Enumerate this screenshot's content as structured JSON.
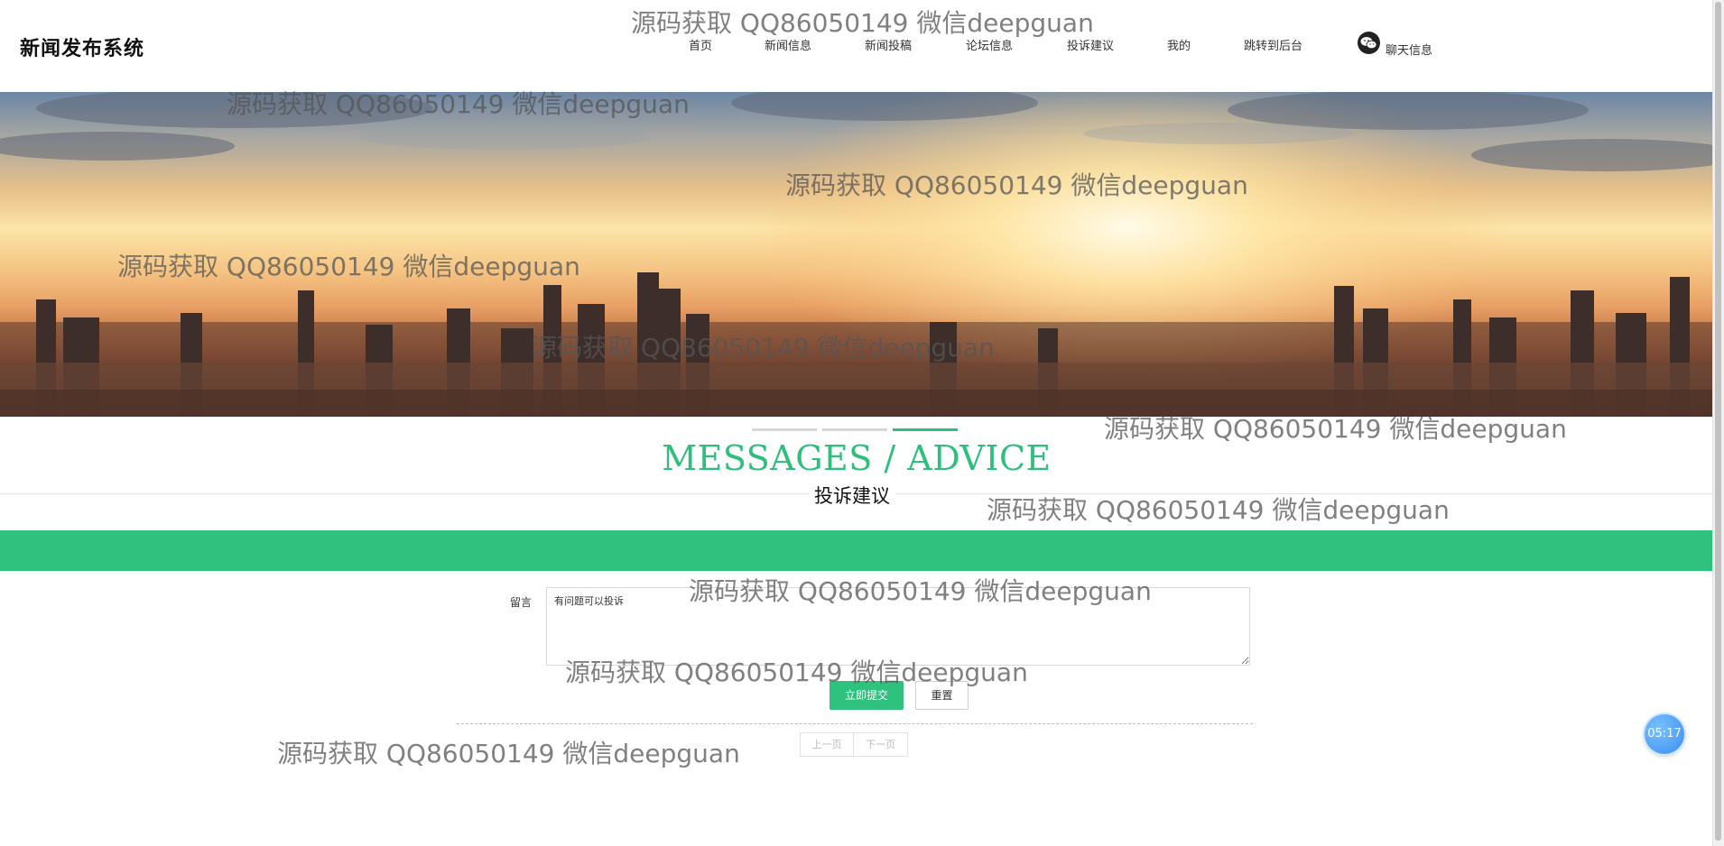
{
  "header": {
    "logo": "新闻发布系统",
    "nav": [
      {
        "label": "首页"
      },
      {
        "label": "新闻信息"
      },
      {
        "label": "新闻投稿"
      },
      {
        "label": "论坛信息"
      },
      {
        "label": "投诉建议"
      },
      {
        "label": "我的"
      },
      {
        "label": "跳转到后台"
      }
    ],
    "chat_label": "聊天信息",
    "chat_icon": "wechat-icon"
  },
  "banner": {
    "carousel_active_index": 2,
    "carousel_count": 3
  },
  "section": {
    "title_en": "MESSAGES / ADVICE",
    "title_cn": "投诉建议"
  },
  "form": {
    "message_label": "留言",
    "message_value": "有问题可以投诉",
    "submit_label": "立即提交",
    "reset_label": "重置"
  },
  "pagination": {
    "prev_label": "上一页",
    "next_label": "下一页"
  },
  "timer": {
    "value": "05:17"
  },
  "watermark": {
    "text": "源码获取 QQ86050149 微信deepguan"
  },
  "colors": {
    "accent": "#2fc27e",
    "title_green": "#2fbf7c",
    "timer_blue": "#3a8df0"
  }
}
